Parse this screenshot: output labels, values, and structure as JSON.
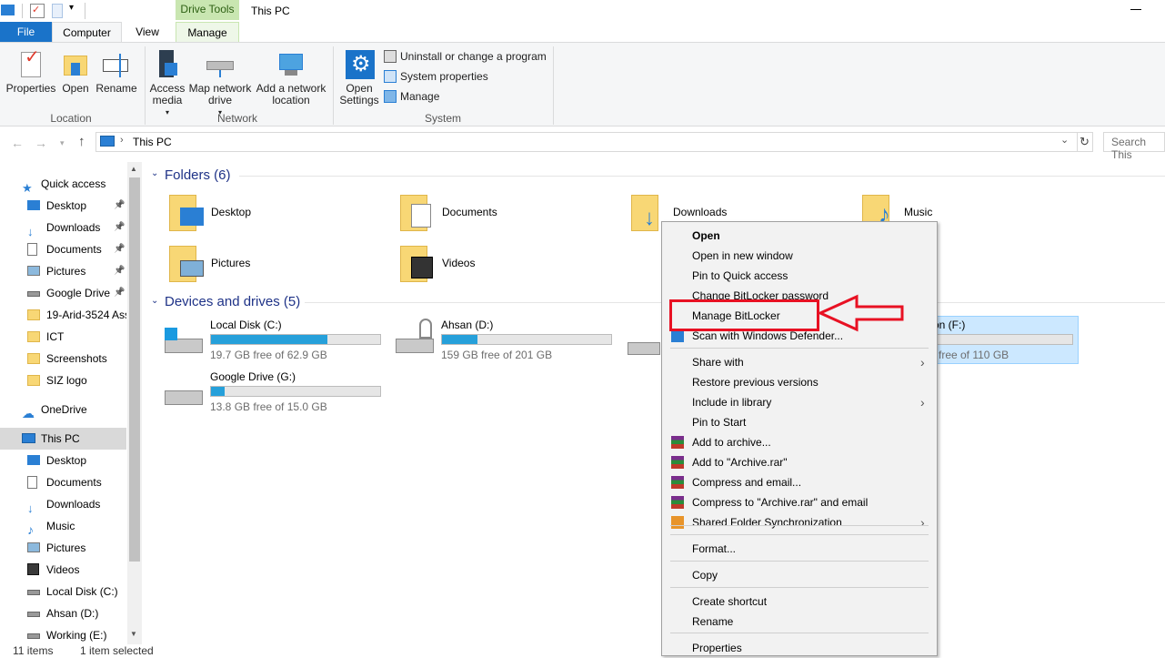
{
  "title_bar": {
    "contextual_tab": "Drive Tools",
    "window_title": "This PC"
  },
  "ribbon_tabs": {
    "file": "File",
    "computer": "Computer",
    "view": "View",
    "manage": "Manage"
  },
  "ribbon": {
    "location": {
      "label": "Location",
      "properties": "Properties",
      "open": "Open",
      "rename": "Rename"
    },
    "network": {
      "label": "Network",
      "access_media": "Access media",
      "map_drive": "Map network drive",
      "add_location": "Add a network location"
    },
    "system": {
      "label": "System",
      "open_settings": "Open Settings",
      "uninstall": "Uninstall or change a program",
      "system_properties": "System properties",
      "manage": "Manage"
    }
  },
  "address": {
    "path": "This PC",
    "search_placeholder": "Search This"
  },
  "sidebar": {
    "items": [
      {
        "label": "Quick access",
        "icon": "star-icon"
      },
      {
        "label": "Desktop",
        "icon": "desktop-icon",
        "pinned": true
      },
      {
        "label": "Downloads",
        "icon": "download-icon",
        "pinned": true
      },
      {
        "label": "Documents",
        "icon": "document-icon",
        "pinned": true
      },
      {
        "label": "Pictures",
        "icon": "pictures-icon",
        "pinned": true
      },
      {
        "label": "Google Drive",
        "icon": "drive-icon",
        "pinned": true
      },
      {
        "label": "19-Arid-3524 Ass",
        "icon": "folder-icon"
      },
      {
        "label": "ICT",
        "icon": "folder-icon"
      },
      {
        "label": "Screenshots",
        "icon": "folder-icon"
      },
      {
        "label": "SIZ logo",
        "icon": "folder-icon"
      },
      {
        "label": "OneDrive",
        "icon": "cloud-icon"
      },
      {
        "label": "This PC",
        "icon": "computer-icon",
        "selected": true
      },
      {
        "label": "Desktop",
        "icon": "desktop-icon"
      },
      {
        "label": "Documents",
        "icon": "document-icon"
      },
      {
        "label": "Downloads",
        "icon": "download-icon"
      },
      {
        "label": "Music",
        "icon": "music-icon"
      },
      {
        "label": "Pictures",
        "icon": "pictures-icon"
      },
      {
        "label": "Videos",
        "icon": "video-icon"
      },
      {
        "label": "Local Disk (C:)",
        "icon": "drive-icon"
      },
      {
        "label": "Ahsan (D:)",
        "icon": "drive-icon"
      },
      {
        "label": "Working (E:)",
        "icon": "drive-icon"
      }
    ]
  },
  "folders": {
    "header": "Folders (6)",
    "items": [
      "Desktop",
      "Documents",
      "Downloads",
      "Music",
      "Pictures",
      "Videos"
    ]
  },
  "drives": {
    "header": "Devices and drives (5)",
    "items": [
      {
        "label": "Local Disk (C:)",
        "free": "19.7 GB free of 62.9 GB",
        "used_fraction": 0.69
      },
      {
        "label": "Ahsan (D:)",
        "free": "159 GB free of 201 GB",
        "used_fraction": 0.21
      },
      {
        "label": "Google Drive (G:)",
        "free": "13.8 GB free of 15.0 GB",
        "used_fraction": 0.08
      },
      {
        "label": "on (F:)",
        "free": "free of 110 GB",
        "used_fraction": 0.0
      }
    ]
  },
  "context_menu": {
    "items": [
      "Open",
      "Open in new window",
      "Pin to Quick access",
      "Change BitLocker password",
      "Manage BitLocker",
      "Scan with Windows Defender...",
      "Share with",
      "Restore previous versions",
      "Include in library",
      "Pin to Start",
      "Add to archive...",
      "Add to \"Archive.rar\"",
      "Compress and email...",
      "Compress to \"Archive.rar\" and email",
      "Shared Folder Synchronization",
      "Format...",
      "Copy",
      "Create shortcut",
      "Rename",
      "Properties"
    ]
  },
  "status": {
    "count": "11 items",
    "selected": "1 item selected"
  },
  "colors": {
    "accent": "#1a73c9",
    "drive_fill": "#26a0da",
    "highlight": "#e81123"
  }
}
